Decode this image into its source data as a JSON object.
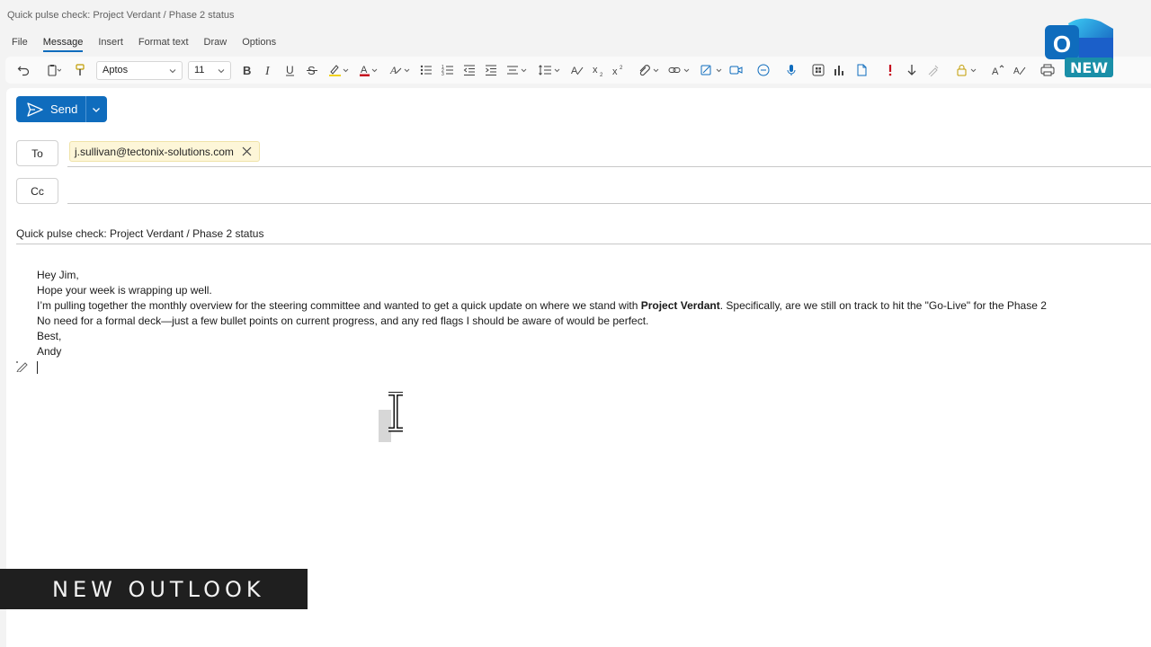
{
  "window": {
    "title": "Quick pulse check: Project Verdant / Phase 2 status"
  },
  "menu": {
    "tabs": [
      {
        "label": "File"
      },
      {
        "label": "Message",
        "active": true
      },
      {
        "label": "Insert"
      },
      {
        "label": "Format text"
      },
      {
        "label": "Draw"
      },
      {
        "label": "Options"
      }
    ]
  },
  "ribbon": {
    "font_family": "Aptos",
    "font_size": "11",
    "icons": [
      "undo-icon",
      "clipboard-icon",
      "format-painter-icon",
      "bold-icon",
      "italic-icon",
      "underline-icon",
      "strikethrough-icon",
      "highlight-icon",
      "font-color-icon",
      "clear-format-icon",
      "bullets-icon",
      "numbering-icon",
      "decrease-indent-icon",
      "increase-indent-icon",
      "align-icon",
      "line-spacing-icon",
      "styles-icon",
      "subscript-icon",
      "superscript-icon",
      "attach-icon",
      "link-icon",
      "signature-icon",
      "meeting-icon",
      "loop-icon",
      "dictate-icon",
      "apps-icon",
      "chart-icon",
      "file-icon",
      "importance-high-icon",
      "importance-low-icon",
      "sensitivity-icon",
      "lock-icon",
      "editor-icon",
      "translate-icon",
      "print-icon"
    ],
    "accent_highlight": "#f2d21d",
    "accent_font_color": "#c50f1f"
  },
  "logo": {
    "letter": "O",
    "badge": "NEW"
  },
  "compose": {
    "send_label": "Send",
    "to_label": "To",
    "cc_label": "Cc",
    "recipient": "j.sullivan@tectonix-solutions.com",
    "cc_value": "",
    "subject": "Quick pulse check: Project Verdant / Phase 2 status",
    "body": {
      "line1": "Hey Jim,",
      "line2": "Hope your week is wrapping up well.",
      "line3_before": "I’m pulling together the monthly overview for the steering committee and wanted to get a quick update on where we stand with ",
      "line3_bold": "Project Verdant",
      "line3_after": ". Specifically, are we still on track to hit the \"Go-Live\" for the Phase 2",
      "line4": "No need for a formal deck—just a few bullet points on current progress, and any red flags I should be aware of would be perfect.",
      "line5": "Best,",
      "line6": "Andy"
    }
  },
  "banner": {
    "text": "NEW OUTLOOK"
  },
  "colors": {
    "brand_blue": "#0f6cbd",
    "chip_background": "#fdf6d8",
    "banner_background": "#1f1f1f"
  }
}
